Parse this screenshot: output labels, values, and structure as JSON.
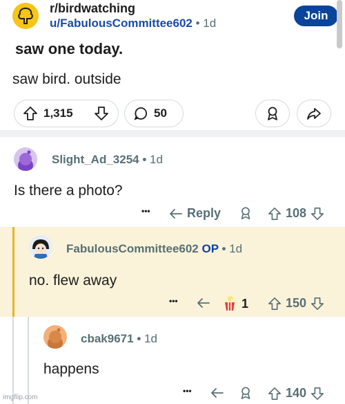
{
  "post": {
    "subreddit": "r/birdwatching",
    "author": "u/FabulousCommittee602",
    "separator": "•",
    "age": "1d",
    "join_label": "Join",
    "title": "saw one today.",
    "body": "saw bird. outside",
    "upvotes": "1,315",
    "comments": "50"
  },
  "comments": [
    {
      "author": "Slight_Ad_3254",
      "separator": "•",
      "age": "1d",
      "text": "Is there a photo?",
      "more": "•••",
      "reply_label": "Reply",
      "score": "108"
    },
    {
      "author": "FabulousCommittee602",
      "op_badge": "OP",
      "separator": "•",
      "age": "1d",
      "text": "no. flew away",
      "more": "•••",
      "award_count": "1",
      "score": "150"
    },
    {
      "author": "cbak9671",
      "separator": "•",
      "age": "1d",
      "text": "happens",
      "more": "•••",
      "score": "140"
    }
  ],
  "watermark": "imgflip.com",
  "colors": {
    "join": "#0a449b",
    "author_link": "#1a4ba8",
    "highlight": "#fbf3d9",
    "highlight_bar": "#e8b428",
    "meta": "#576f76"
  }
}
